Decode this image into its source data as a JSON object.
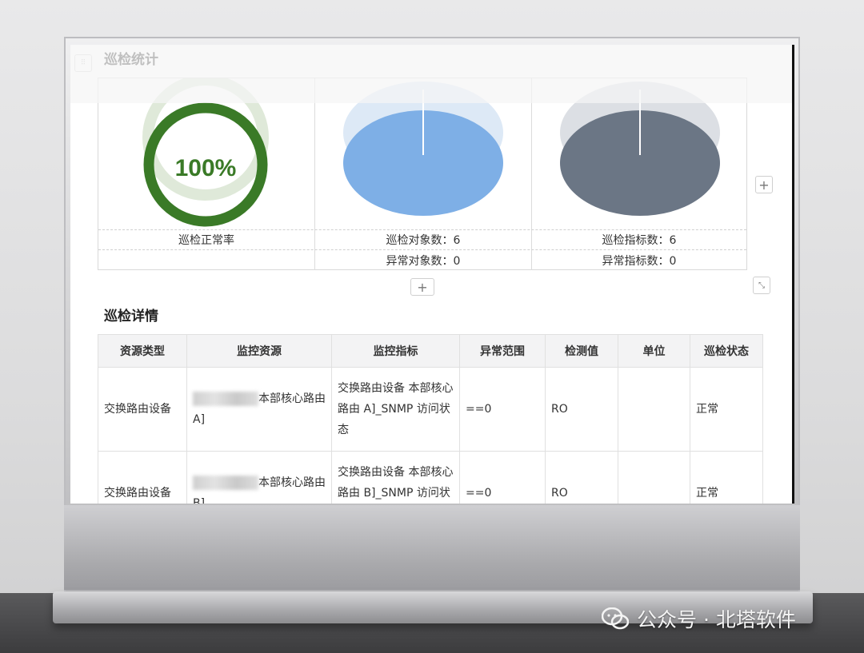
{
  "panel": {
    "title": "巡检统计"
  },
  "stats": {
    "normal_rate": {
      "value_text": "100%",
      "label": "巡检正常率",
      "color": "#3a7a27"
    },
    "objects": {
      "label_count": "巡检对象数：6",
      "label_abnormal": "异常对象数：0",
      "color": "#7eafe6"
    },
    "indicators": {
      "label_count": "巡检指标数：6",
      "label_abnormal": "异常指标数：0",
      "color": "#6b7685"
    }
  },
  "controls": {
    "add_label": "+",
    "expand_icon": "expand-icon"
  },
  "detail": {
    "title": "巡检详情",
    "columns": [
      "资源类型",
      "监控资源",
      "监控指标",
      "异常范围",
      "检测值",
      "单位",
      "巡检状态"
    ],
    "rows": [
      {
        "type": "交换路由设备",
        "resource": "本部核心路由 A]",
        "indicator": "交换路由设备 本部核心路由 A]_SNMP 访问状态",
        "range": "==0",
        "value": "RO",
        "unit": "",
        "status": "正常"
      },
      {
        "type": "交换路由设备",
        "resource": "本部核心路由 B]",
        "indicator": "交换路由设备 本部核心路由 B]_SNMP 访问状态",
        "range": "==0",
        "value": "RO",
        "unit": "",
        "status": "正常"
      }
    ]
  },
  "watermark": {
    "text": "公众号 · 北塔软件",
    "icon": "wechat-icon"
  }
}
